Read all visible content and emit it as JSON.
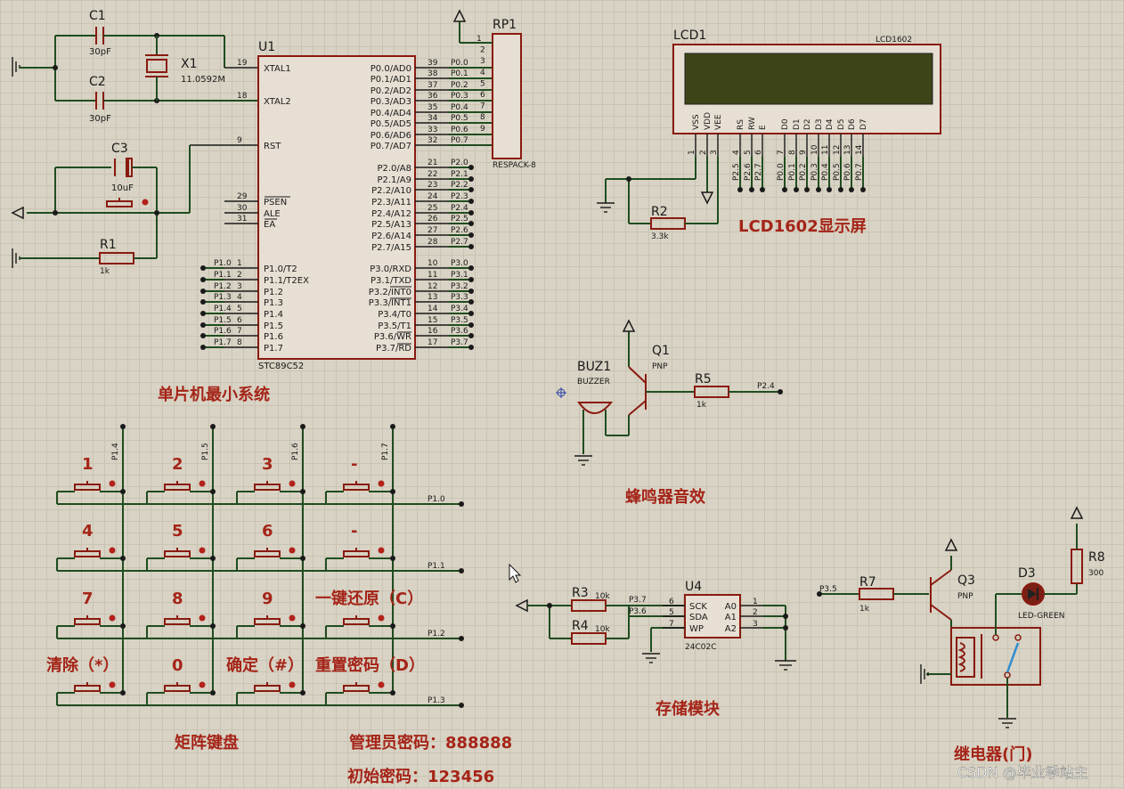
{
  "u1": {
    "ref": "U1",
    "part": "STC89C52",
    "left_pins": [
      {
        "num": "19",
        "name": "XTAL1"
      },
      {
        "num": "18",
        "name": "XTAL2"
      },
      {
        "num": "9",
        "name": "RST"
      },
      {
        "num": "29",
        "name": "PSEN"
      },
      {
        "num": "30",
        "name": "ALE"
      },
      {
        "num": "31",
        "name": "EA"
      },
      {
        "num": "1",
        "name": "P1.0/T2",
        "net": "P1.0"
      },
      {
        "num": "2",
        "name": "P1.1/T2EX",
        "net": "P1.1"
      },
      {
        "num": "3",
        "name": "P1.2",
        "net": "P1.2"
      },
      {
        "num": "4",
        "name": "P1.3",
        "net": "P1.3"
      },
      {
        "num": "5",
        "name": "P1.4",
        "net": "P1.4"
      },
      {
        "num": "6",
        "name": "P1.5",
        "net": "P1.5"
      },
      {
        "num": "7",
        "name": "P1.6",
        "net": "P1.6"
      },
      {
        "num": "8",
        "name": "P1.7",
        "net": "P1.7"
      }
    ],
    "right_pins": [
      {
        "num": "39",
        "name": "P0.0/AD0",
        "net": "P0.0"
      },
      {
        "num": "38",
        "name": "P0.1/AD1",
        "net": "P0.1"
      },
      {
        "num": "37",
        "name": "P0.2/AD2",
        "net": "P0.2"
      },
      {
        "num": "36",
        "name": "P0.3/AD3",
        "net": "P0.3"
      },
      {
        "num": "35",
        "name": "P0.4/AD4",
        "net": "P0.4"
      },
      {
        "num": "34",
        "name": "P0.5/AD5",
        "net": "P0.5"
      },
      {
        "num": "33",
        "name": "P0.6/AD6",
        "net": "P0.6"
      },
      {
        "num": "32",
        "name": "P0.7/AD7",
        "net": "P0.7"
      },
      {
        "num": "21",
        "name": "P2.0/A8",
        "net": "P2.0"
      },
      {
        "num": "22",
        "name": "P2.1/A9",
        "net": "P2.1"
      },
      {
        "num": "23",
        "name": "P2.2/A10",
        "net": "P2.2"
      },
      {
        "num": "24",
        "name": "P2.3/A11",
        "net": "P2.3"
      },
      {
        "num": "25",
        "name": "P2.4/A12",
        "net": "P2.4"
      },
      {
        "num": "26",
        "name": "P2.5/A13",
        "net": "P2.5"
      },
      {
        "num": "27",
        "name": "P2.6/A14",
        "net": "P2.6"
      },
      {
        "num": "28",
        "name": "P2.7/A15",
        "net": "P2.7"
      },
      {
        "num": "10",
        "name": "P3.0/RXD",
        "net": "P3.0"
      },
      {
        "num": "11",
        "name": "P3.1/TXD",
        "net": "P3.1"
      },
      {
        "num": "12",
        "name": "P3.2/INT0",
        "net": "P3.2"
      },
      {
        "num": "13",
        "name": "P3.3/INT1",
        "net": "P3.3"
      },
      {
        "num": "14",
        "name": "P3.4/T0",
        "net": "P3.4"
      },
      {
        "num": "15",
        "name": "P3.5/T1",
        "net": "P3.5"
      },
      {
        "num": "16",
        "name": "P3.6/WR",
        "net": "P3.6"
      },
      {
        "num": "17",
        "name": "P3.7/RD",
        "net": "P3.7"
      }
    ]
  },
  "rp1": {
    "ref": "RP1",
    "part": "RESPACK-8",
    "pins": [
      "1",
      "2",
      "3",
      "4",
      "5",
      "6",
      "7",
      "8",
      "9"
    ]
  },
  "c1": {
    "ref": "C1",
    "value": "30pF"
  },
  "c2": {
    "ref": "C2",
    "value": "30pF"
  },
  "c3": {
    "ref": "C3",
    "value": "10uF"
  },
  "x1": {
    "ref": "X1",
    "value": "11.0592M"
  },
  "r1": {
    "ref": "R1",
    "value": "1k"
  },
  "lcd": {
    "ref": "LCD1",
    "part": "LCD1602",
    "pins": [
      {
        "name": "VSS",
        "num": "1"
      },
      {
        "name": "VDD",
        "num": "2"
      },
      {
        "name": "VEE",
        "num": "3"
      },
      {
        "name": "RS",
        "num": "4",
        "net": "P2.5"
      },
      {
        "name": "RW",
        "num": "5",
        "net": "P2.6"
      },
      {
        "name": "E",
        "num": "6",
        "net": "P2.7"
      },
      {
        "name": "D0",
        "num": "7",
        "net": "P0.0"
      },
      {
        "name": "D1",
        "num": "8",
        "net": "P0.1"
      },
      {
        "name": "D2",
        "num": "9",
        "net": "P0.2"
      },
      {
        "name": "D3",
        "num": "10",
        "net": "P0.3"
      },
      {
        "name": "D4",
        "num": "11",
        "net": "P0.4"
      },
      {
        "name": "D5",
        "num": "12",
        "net": "P0.5"
      },
      {
        "name": "D6",
        "num": "13",
        "net": "P0.6"
      },
      {
        "name": "D7",
        "num": "14",
        "net": "P0.7"
      }
    ]
  },
  "r2": {
    "ref": "R2",
    "value": "3.3k"
  },
  "buzzer": {
    "ref": "BUZ1",
    "part": "BUZZER"
  },
  "q1": {
    "ref": "Q1",
    "part": "PNP"
  },
  "r5": {
    "ref": "R5",
    "value": "1k",
    "net": "P2.4"
  },
  "u4": {
    "ref": "U4",
    "part": "24C02C",
    "left_pins": [
      {
        "num": "6",
        "name": "SCK"
      },
      {
        "num": "5",
        "name": "SDA"
      },
      {
        "num": "7",
        "name": "WP"
      }
    ],
    "right_pins": [
      {
        "num": "1",
        "name": "A0"
      },
      {
        "num": "2",
        "name": "A1"
      },
      {
        "num": "3",
        "name": "A2"
      }
    ]
  },
  "r3": {
    "ref": "R3",
    "value": "10k",
    "net": "P3.7"
  },
  "r4": {
    "ref": "R4",
    "value": "10k",
    "net": "P3.6"
  },
  "relay": {
    "r7": {
      "ref": "R7",
      "value": "1k",
      "net": "P3.5"
    },
    "q3": {
      "ref": "Q3",
      "part": "PNP"
    },
    "d3": {
      "ref": "D3",
      "part": "LED-GREEN"
    },
    "r8": {
      "ref": "R8",
      "value": "300"
    }
  },
  "keypad": {
    "col_nets": [
      "P1.4",
      "P1.5",
      "P1.6",
      "P1.7"
    ],
    "row_nets": [
      "P1.0",
      "P1.1",
      "P1.2",
      "P1.3"
    ],
    "keys": [
      [
        "1",
        "2",
        "3",
        "-"
      ],
      [
        "4",
        "5",
        "6",
        "-"
      ],
      [
        "7",
        "8",
        "9",
        "一键还原（C）"
      ],
      [
        "清除（*）",
        "0",
        "确定（#）",
        "重置密码（D）"
      ]
    ]
  },
  "titles": {
    "mcu": "单片机最小系统",
    "lcd": "LCD1602显示屏",
    "buzzer": "蜂鸣器音效",
    "storage": "存储模块",
    "relay": "继电器(门)",
    "keypad": "矩阵键盘",
    "admin_pwd": "管理员密码：888888",
    "init_pwd": "初始密码：123456",
    "watermark": "CSDN @毕业季站主"
  },
  "colors": {
    "background": "#d8d3c4",
    "grid": "#c9c3b3",
    "component": "#8a1a10",
    "wire": "#1f4d1f",
    "title": "#a52418",
    "lcd_screen": "#3d4418"
  }
}
